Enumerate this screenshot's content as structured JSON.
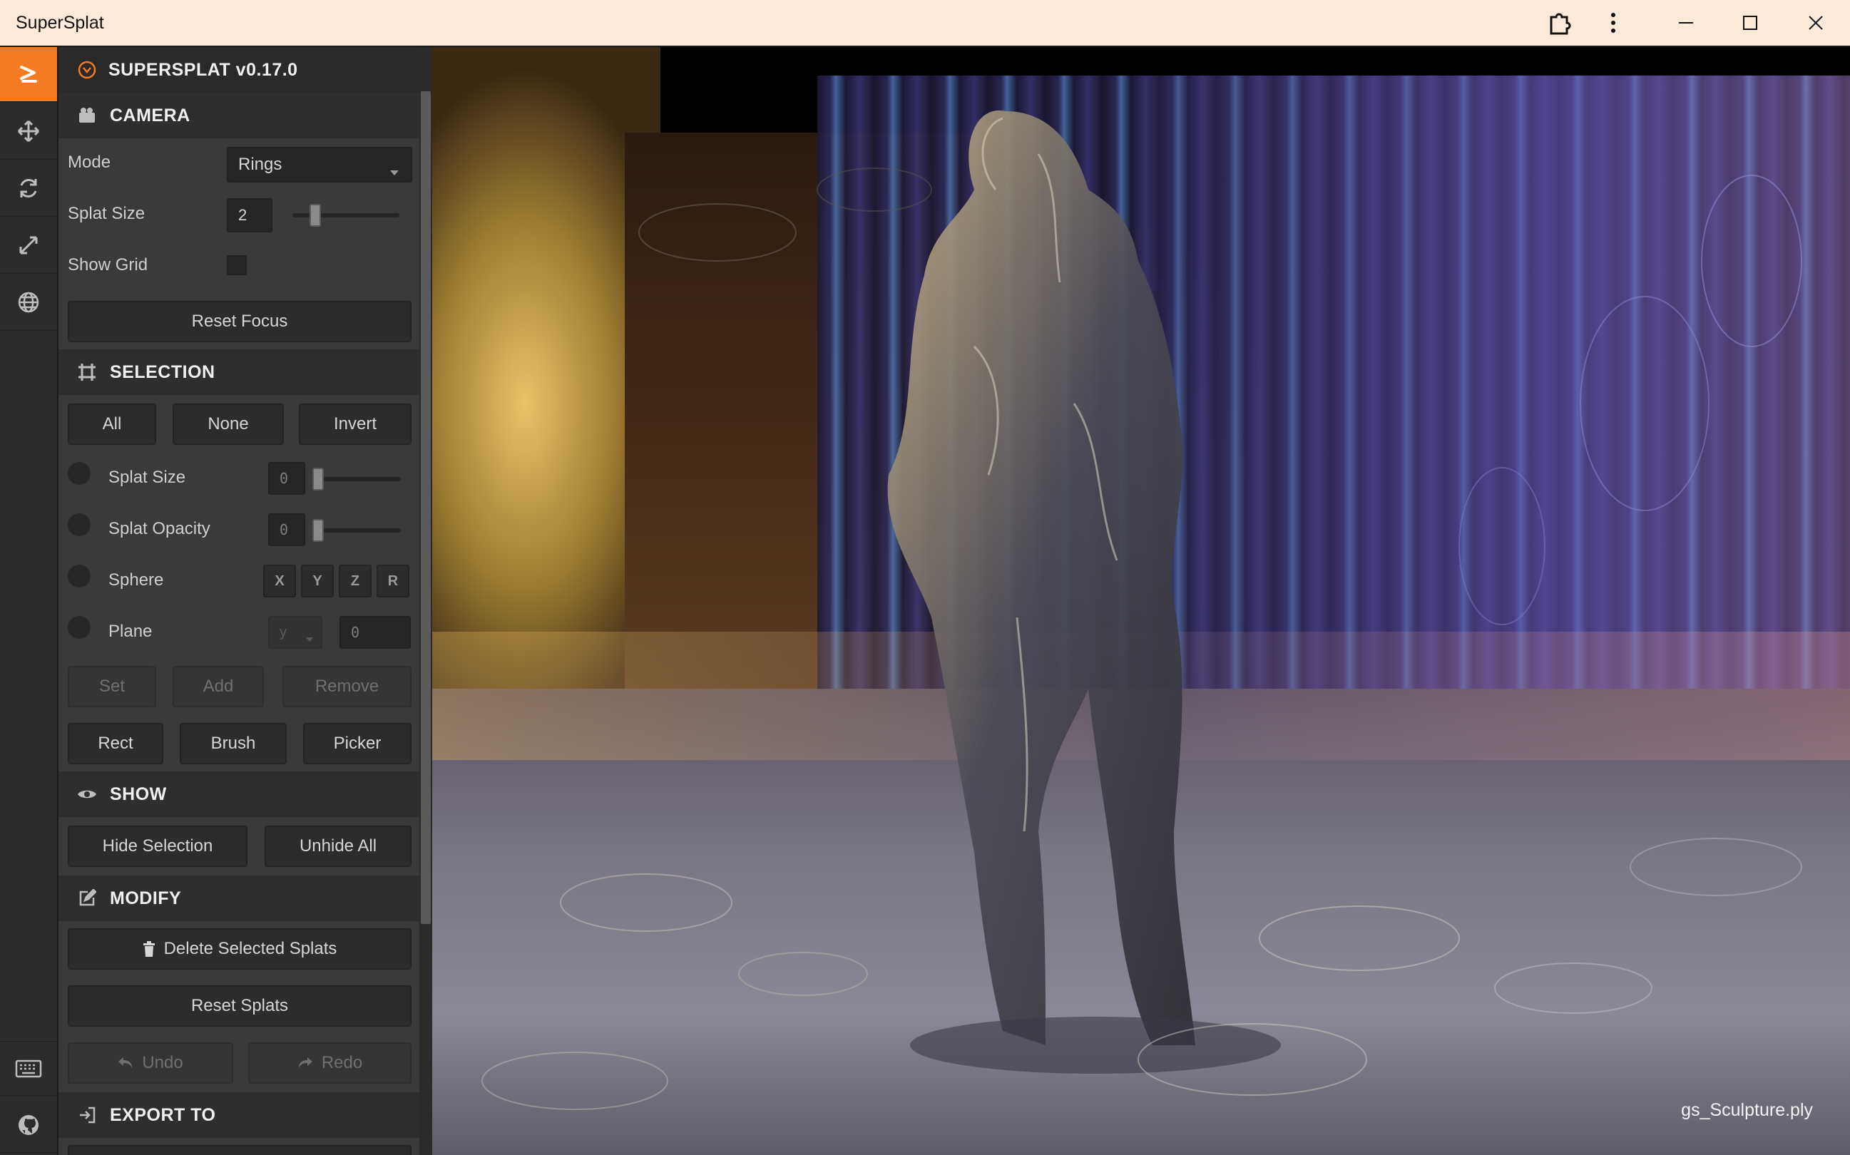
{
  "window": {
    "title": "SuperSplat"
  },
  "toolbar": {
    "items": [
      "logo-icon",
      "move-icon",
      "rotate-icon",
      "scale-icon",
      "globe-icon"
    ],
    "bottom_items": [
      "keyboard-icon",
      "github-icon"
    ],
    "accent": "#f47b22"
  },
  "panel": {
    "app_title": "SUPERSPLAT v0.17.0",
    "camera": {
      "title": "CAMERA",
      "mode_label": "Mode",
      "mode_value": "Rings",
      "splat_size_label": "Splat Size",
      "splat_size_value": "2",
      "splat_size_slider": 0.2,
      "show_grid_label": "Show Grid",
      "show_grid_checked": false,
      "reset_focus": "Reset Focus"
    },
    "selection": {
      "title": "SELECTION",
      "all": "All",
      "none": "None",
      "invert": "Invert",
      "splat_size_label": "Splat Size",
      "splat_size_value": "0",
      "splat_opacity_label": "Splat Opacity",
      "splat_opacity_value": "0",
      "sphere_label": "Sphere",
      "sphere_axes": [
        "X",
        "Y",
        "Z",
        "R"
      ],
      "plane_label": "Plane",
      "plane_axis": "y",
      "plane_value": "0",
      "set": "Set",
      "add": "Add",
      "remove": "Remove",
      "rect": "Rect",
      "brush": "Brush",
      "picker": "Picker"
    },
    "show": {
      "title": "SHOW",
      "hide_selection": "Hide Selection",
      "unhide_all": "Unhide All"
    },
    "modify": {
      "title": "MODIFY",
      "delete_selected": "Delete Selected Splats",
      "reset_splats": "Reset Splats",
      "undo": "Undo",
      "redo": "Redo"
    },
    "export": {
      "title": "EXPORT TO"
    }
  },
  "viewport": {
    "filename": "gs_Sculpture.ply"
  }
}
